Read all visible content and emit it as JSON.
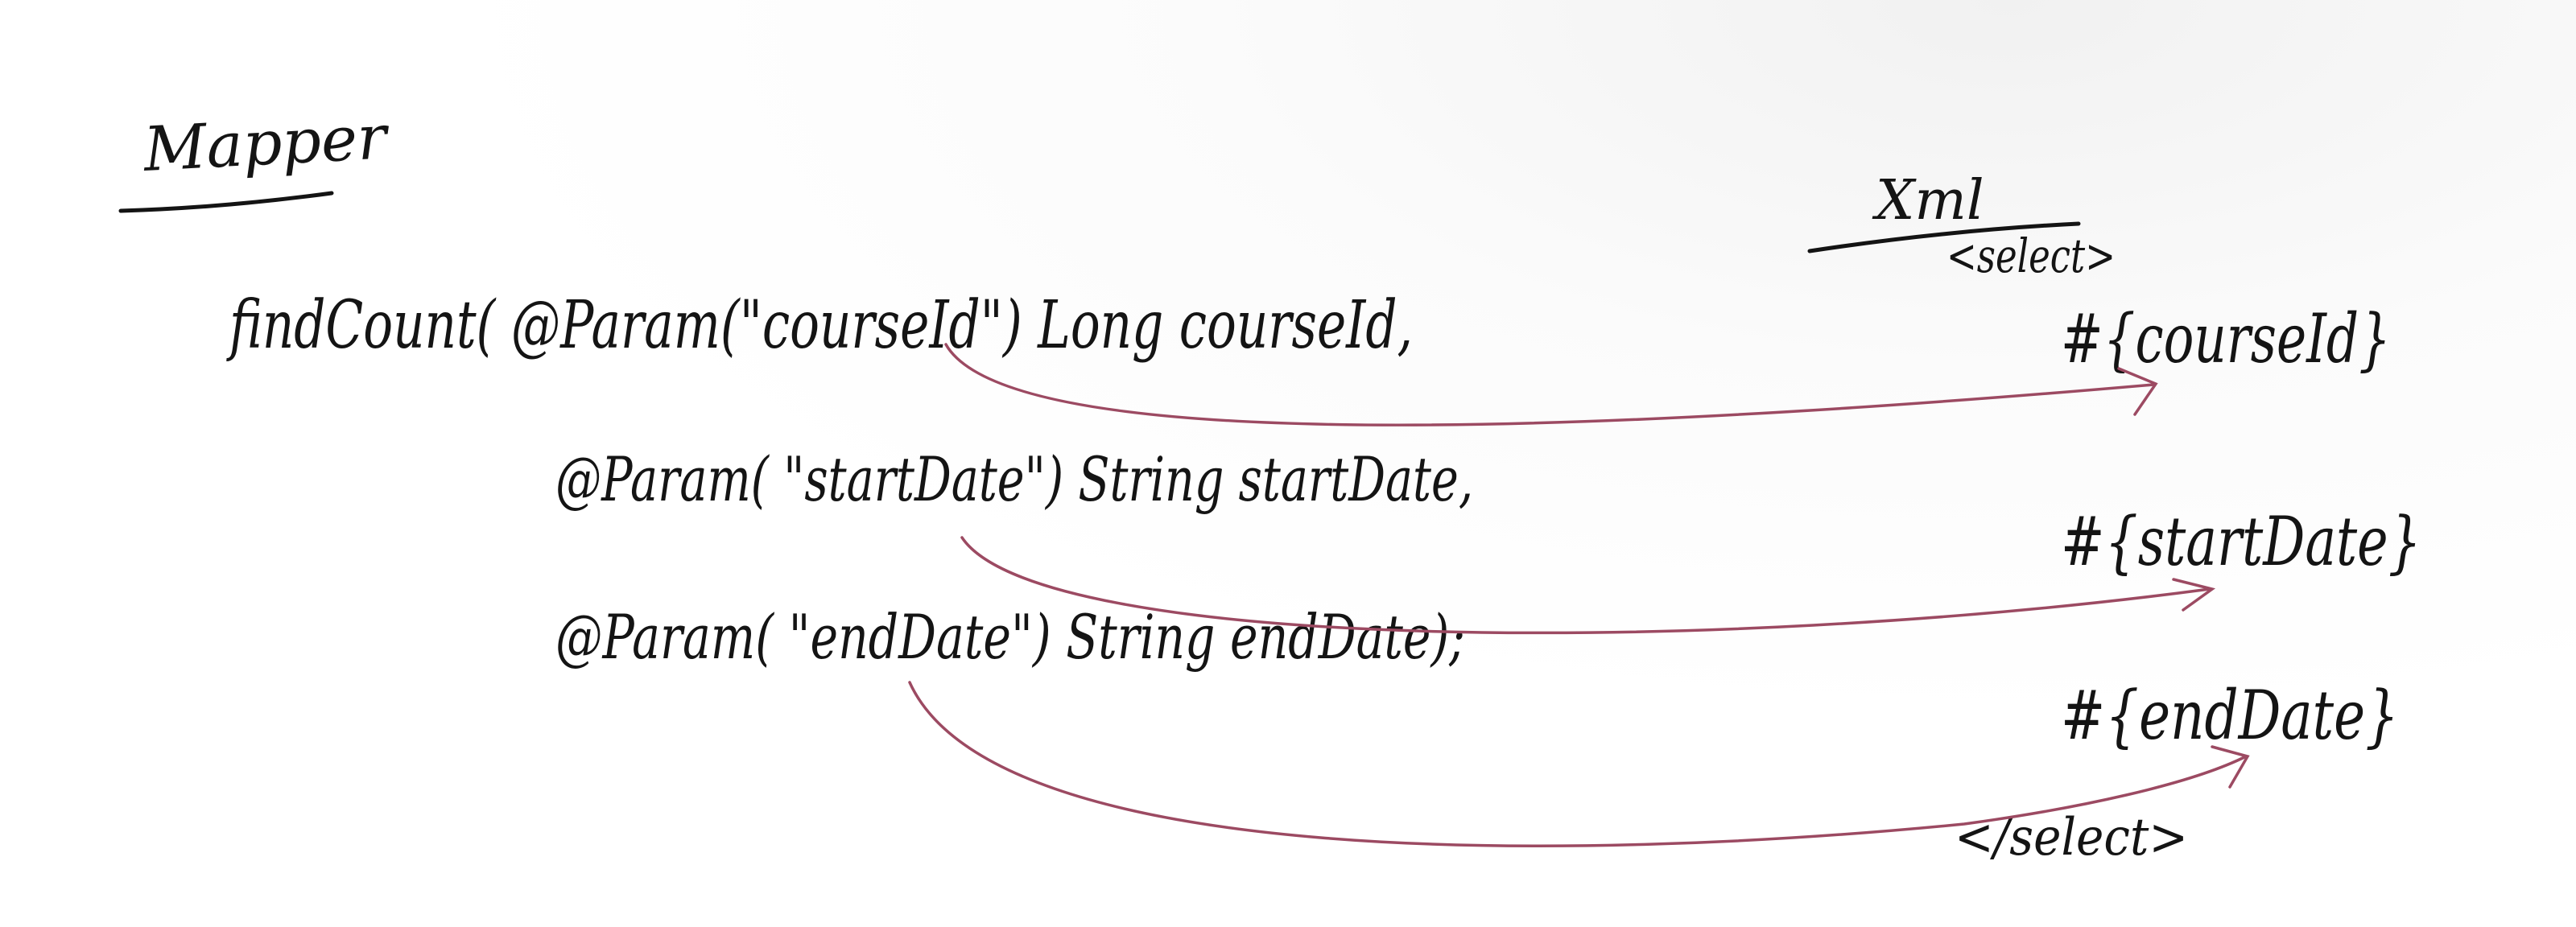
{
  "mapper": {
    "heading": "Mapper",
    "line_1": "findCount( @Param(\"courseId\") Long courseId,",
    "line_2": "@Param( \"startDate\") String startDate,",
    "line_3": "@Param( \"endDate\")  String  endDate);"
  },
  "xml": {
    "heading": "Xml",
    "select_open": "<select>",
    "param_1": "#{courseId}",
    "param_2": "#{startDate}",
    "param_3": "#{endDate}",
    "select_close": "</select>"
  },
  "colors": {
    "ink": "#141414",
    "arrow": "#9c4a62"
  }
}
